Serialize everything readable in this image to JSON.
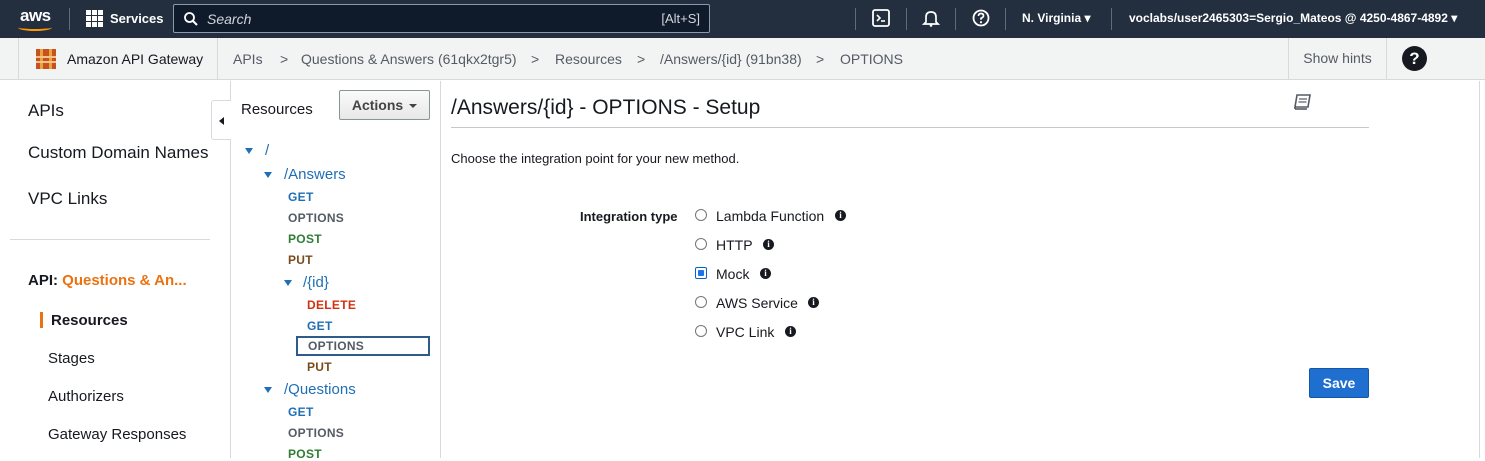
{
  "topnav": {
    "logo": "aws",
    "services_label": "Services",
    "search_placeholder": "Search",
    "search_shortcut": "[Alt+S]",
    "region": "N. Virginia",
    "account": "voclabs/user2465303=Sergio_Mateos @ 4250-4867-4892",
    "icons": [
      "cloudshell-icon",
      "bell-icon",
      "help-circle-icon"
    ]
  },
  "breadcrumb": {
    "service_name": "Amazon API Gateway",
    "items": [
      "APIs",
      "Questions & Answers (61qkx2tgr5)",
      "Resources",
      "/Answers/{id} (91bn38)",
      "OPTIONS"
    ],
    "separator": ">",
    "show_hints": "Show hints",
    "help": "?"
  },
  "sidebar": {
    "items": [
      "APIs",
      "Custom Domain Names",
      "VPC Links"
    ],
    "api_prefix": "API:",
    "api_name": "Questions & An...",
    "sub_items": [
      "Resources",
      "Stages",
      "Authorizers",
      "Gateway Responses"
    ],
    "active": "Resources"
  },
  "resources": {
    "header": "Resources",
    "actions_label": "Actions",
    "tree": {
      "root": "/",
      "answers": "/Answers",
      "answers_methods": [
        "GET",
        "OPTIONS",
        "POST",
        "PUT"
      ],
      "id": "/{id}",
      "id_methods": [
        "DELETE",
        "GET",
        "OPTIONS",
        "PUT"
      ],
      "questions": "/Questions",
      "questions_methods": [
        "GET",
        "OPTIONS",
        "POST"
      ]
    },
    "selected": "OPTIONS"
  },
  "main": {
    "title": "/Answers/{id} - OPTIONS - Setup",
    "intro": "Choose the integration point for your new method.",
    "integration_label": "Integration type",
    "options": [
      "Lambda Function",
      "HTTP",
      "Mock",
      "AWS Service",
      "VPC Link"
    ],
    "selected_option": "Mock",
    "save_label": "Save",
    "info_glyph": "i"
  },
  "colors": {
    "nav_bg": "#232f3e",
    "accent_orange": "#ec7211",
    "link_blue": "#1f6fb5",
    "primary_button": "#1f6fd1"
  }
}
